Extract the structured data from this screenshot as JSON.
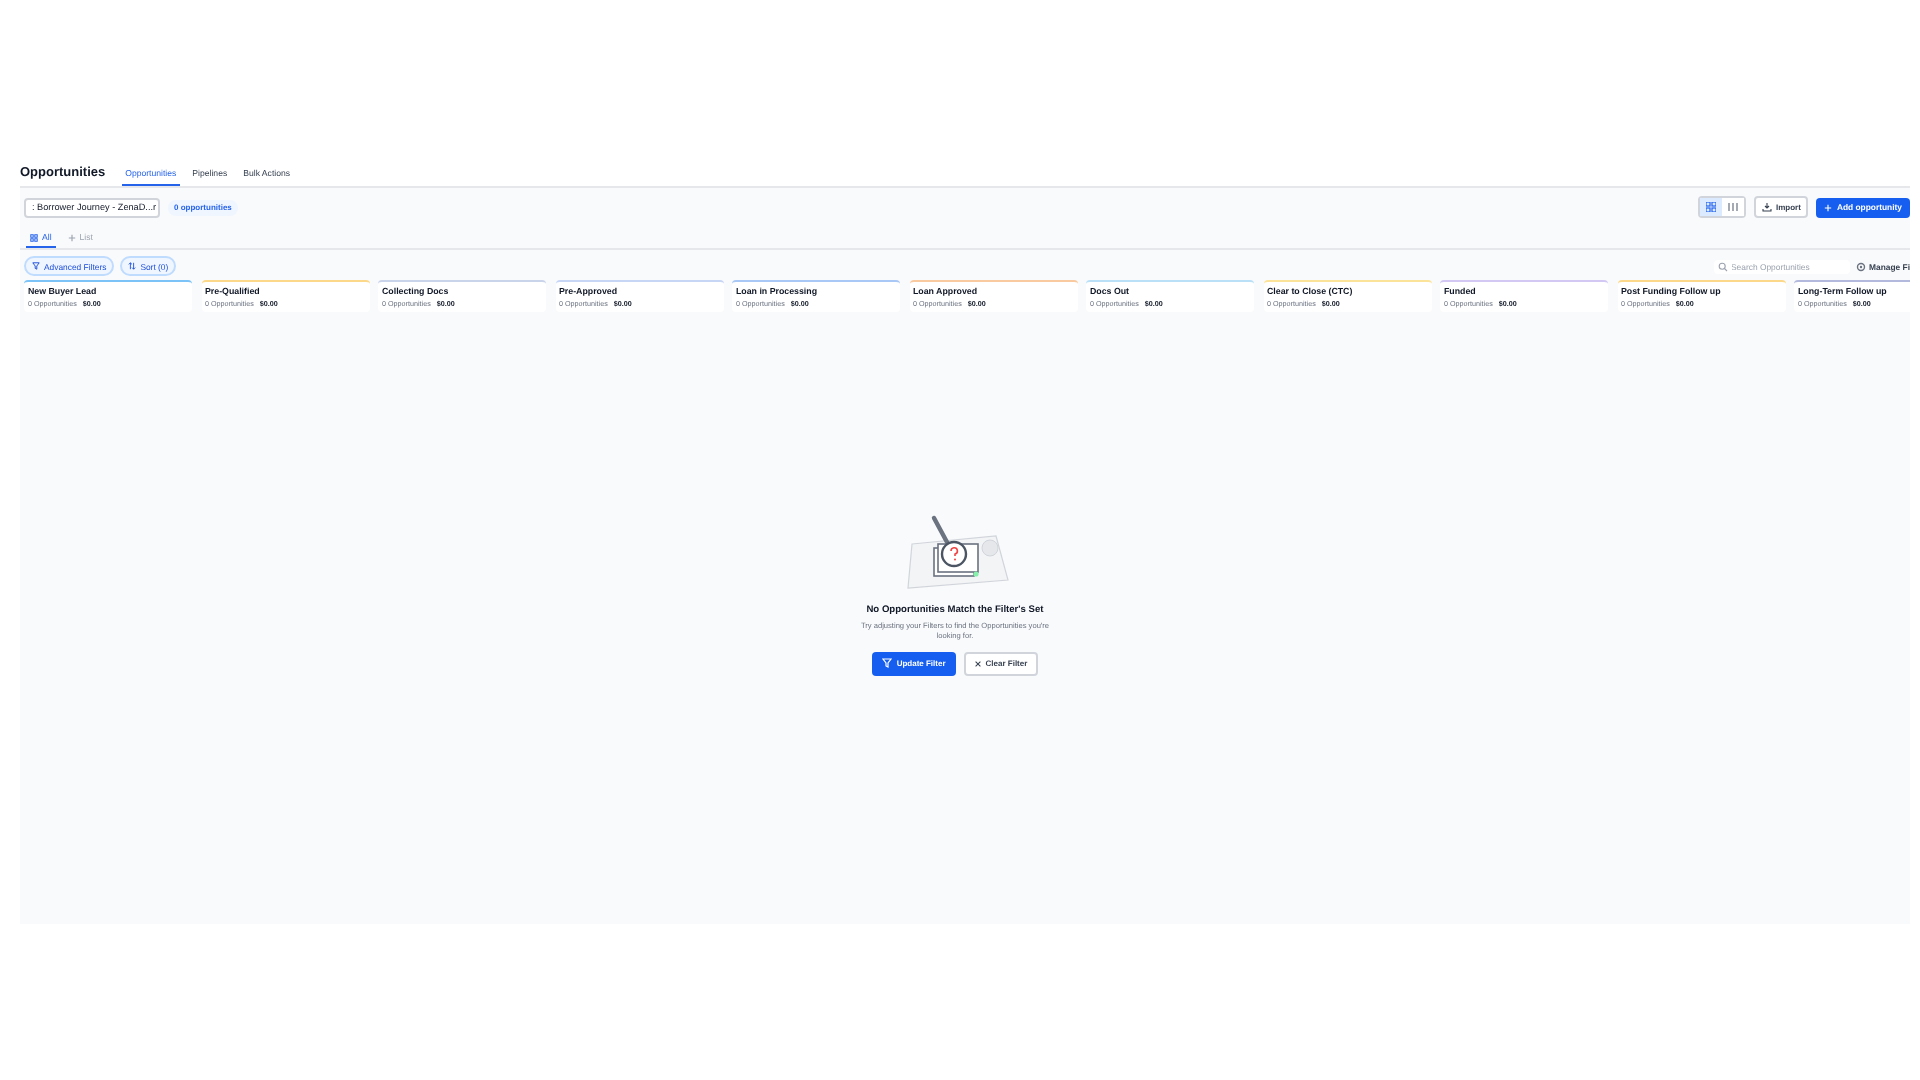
{
  "page_title": "Opportunities",
  "nav_tabs": [
    {
      "label": "Opportunities",
      "selected": true
    },
    {
      "label": "Pipelines",
      "selected": false
    },
    {
      "label": "Bulk Actions",
      "selected": false
    }
  ],
  "pipeline_select": {
    "value": ": Borrower Journey - ZenaD...r"
  },
  "count_badge": "0 opportunities",
  "view_toggle": [
    {
      "kind": "grid",
      "selected": true
    },
    {
      "kind": "list",
      "selected": false
    }
  ],
  "import_button": "Import",
  "add_button": "Add opportunity",
  "view_tabs": [
    {
      "label": "All",
      "kind": "all",
      "selected": true
    },
    {
      "label": "List",
      "kind": "add",
      "selected": false
    }
  ],
  "filter_buttons": [
    {
      "label": "Advanced Filters",
      "kind": "filter"
    },
    {
      "label": "Sort (0)",
      "kind": "sort"
    }
  ],
  "search": {
    "placeholder": "Search Opportunities"
  },
  "manage_button": "Manage Fi",
  "stages": [
    {
      "name": "New Buyer Lead",
      "count": "0 Opportunities",
      "amount": "$0.00",
      "color": "#7cc4f8"
    },
    {
      "name": "Pre-Qualified",
      "count": "0 Opportunities",
      "amount": "$0.00",
      "color": "#fcd88a"
    },
    {
      "name": "Collecting Docs",
      "count": "0 Opportunities",
      "amount": "$0.00",
      "color": "#c9d3ea"
    },
    {
      "name": "Pre-Approved",
      "count": "0 Opportunities",
      "amount": "$0.00",
      "color": "#c7d6f5"
    },
    {
      "name": "Loan in Processing",
      "count": "0 Opportunities",
      "amount": "$0.00",
      "color": "#a9c8f5"
    },
    {
      "name": "Loan Approved",
      "count": "0 Opportunities",
      "amount": "$0.00",
      "color": "#f9c9a0"
    },
    {
      "name": "Docs Out",
      "count": "0 Opportunities",
      "amount": "$0.00",
      "color": "#b9e0f7"
    },
    {
      "name": "Clear to Close (CTC)",
      "count": "0 Opportunities",
      "amount": "$0.00",
      "color": "#fbe39a"
    },
    {
      "name": "Funded",
      "count": "0 Opportunities",
      "amount": "$0.00",
      "color": "#d3c8f3"
    },
    {
      "name": "Post Funding Follow up",
      "count": "0 Opportunities",
      "amount": "$0.00",
      "color": "#fcd88a"
    },
    {
      "name": "Long-Term Follow up",
      "count": "0 Opportunities",
      "amount": "$0.00",
      "color": "#b3b9dd"
    }
  ],
  "empty_state": {
    "title": "No Opportunities Match the Filter's Set",
    "message": "Try adjusting your Filters to find the Opportunities you're looking for.",
    "primary_button": "Update Filter",
    "secondary_button": "Clear Filter"
  }
}
